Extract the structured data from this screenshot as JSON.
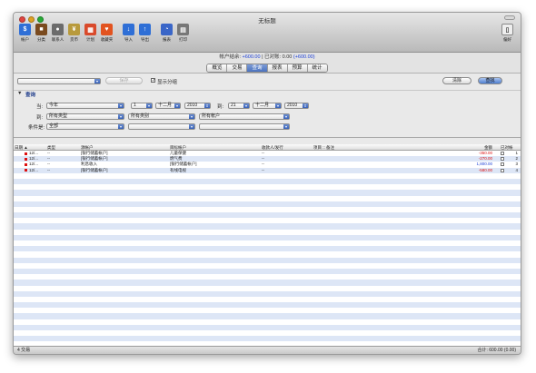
{
  "window": {
    "title": "无标题"
  },
  "toolbar": {
    "items": [
      {
        "label": "帐户",
        "icon": "dollar-icon",
        "color": "#2f6fd6",
        "glyph": "$"
      },
      {
        "label": "分类",
        "icon": "briefcase-icon",
        "color": "#7a4a1e",
        "glyph": "■"
      },
      {
        "label": "联系人",
        "icon": "person-icon",
        "color": "#6b6b6b",
        "glyph": "●"
      },
      {
        "label": "货币",
        "icon": "currency-icon",
        "color": "#b89a3c",
        "glyph": "¥"
      },
      {
        "label": "计划",
        "icon": "calendar-icon",
        "color": "#d94a2b",
        "glyph": "▦"
      },
      {
        "label": "收藏夹",
        "icon": "heart-icon",
        "color": "#e2531f",
        "glyph": "♥"
      },
      {
        "label": "导入",
        "icon": "import-icon",
        "color": "#2f6fd6",
        "glyph": "↓"
      },
      {
        "label": "导出",
        "icon": "export-icon",
        "color": "#2f6fd6",
        "glyph": "↑"
      },
      {
        "label": "报表",
        "icon": "pie-chart-icon",
        "color": "#3a66c8",
        "glyph": "◔"
      },
      {
        "label": "打印",
        "icon": "printer-icon",
        "color": "#777777",
        "glyph": "▤"
      }
    ],
    "prefs": {
      "label": "偏好",
      "icon": "switch-icon",
      "glyph": "▯"
    }
  },
  "balance": {
    "prefix": "帐户结余:",
    "amount": "+600.00",
    "sep": "| 已对账:",
    "reconciled": "0.00",
    "reconciled_paren": "(+600.00)"
  },
  "tabs": [
    {
      "label": "概览",
      "active": false
    },
    {
      "label": "交易",
      "active": false
    },
    {
      "label": "查询",
      "active": true
    },
    {
      "label": "报表",
      "active": false
    },
    {
      "label": "预算",
      "active": false
    },
    {
      "label": "统计",
      "active": false
    }
  ],
  "search": {
    "save_label": "保存",
    "show_split_label": "显示分组",
    "show_split_checked": true,
    "clear_label": "清除",
    "find_label": "查找"
  },
  "query": {
    "title": "查询",
    "when_label": "当:",
    "when_value": "今年",
    "from_day": "1",
    "from_month": "十二月",
    "from_year": "2010",
    "to_label": "到:",
    "to_day": "21",
    "to_month": "十二月",
    "to_year": "2010",
    "type_label": "到:",
    "type_value": "所有类型",
    "category_value": "所有类别",
    "account_value": "所有帐户",
    "cond_label": "条件是:",
    "cond_value": "全部"
  },
  "table": {
    "columns": [
      "日期",
      "类型",
      "源帐户",
      "目标帐户",
      "收款人/发行",
      "项目 :: 备注",
      "金额",
      "已对帐"
    ],
    "rows": [
      {
        "date": "12/...",
        "type": "--",
        "source": "[银行储蓄帐户]",
        "target": "儿童保健",
        "payee": "--",
        "amount": "-350.00",
        "sign": "neg",
        "num": "1"
      },
      {
        "date": "12/...",
        "type": "--",
        "source": "[银行储蓄帐户]",
        "target": "燃气费",
        "payee": "--",
        "amount": "-270.00",
        "sign": "neg",
        "num": "2"
      },
      {
        "date": "12/...",
        "type": "--",
        "source": "利息收入",
        "target": "[银行储蓄帐户]",
        "payee": "--",
        "amount": "1,800.00",
        "sign": "pos",
        "num": "3"
      },
      {
        "date": "12/...",
        "type": "--",
        "source": "[银行储蓄帐户]",
        "target": "有线电视",
        "payee": "--",
        "amount": "-580.00",
        "sign": "neg",
        "num": "4"
      }
    ]
  },
  "status": {
    "count": "4 交易",
    "total": "合计: 600.00 (0.00)"
  },
  "colors": {
    "accent": "#4a72bf",
    "negative": "#d11111",
    "positive": "#1c3fd6",
    "stripe": "#dde6f6"
  }
}
